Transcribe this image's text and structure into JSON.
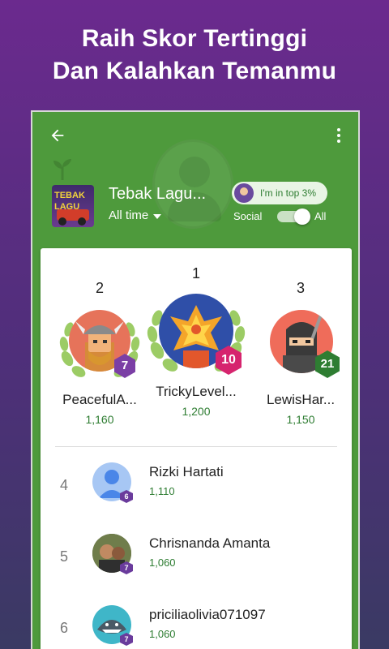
{
  "headline": {
    "line1": "Raih Skor Tertinggi",
    "line2": "Dan Kalahkan Temanmu"
  },
  "appbar": {
    "back_icon": "arrow-back-icon",
    "menu_icon": "more-vert-icon"
  },
  "game": {
    "title": "Tebak Lagu...",
    "icon_text": "TEBAK LAGU",
    "time_filter": "All time",
    "top_badge": "I'm in top 3%",
    "toggle_left": "Social",
    "toggle_right": "All",
    "toggle_on": true
  },
  "podium": [
    {
      "rank": "2",
      "name": "PeacefulA...",
      "score": "1,160",
      "level": "7",
      "level_color": "#7b3fa5",
      "avatar": "viking-avatar"
    },
    {
      "rank": "1",
      "name": "TrickyLevel...",
      "score": "1,200",
      "level": "10",
      "level_color": "#d6246e",
      "avatar": "phoenix-avatar"
    },
    {
      "rank": "3",
      "name": "LewisHar...",
      "score": "1,150",
      "level": "21",
      "level_color": "#2e7d32",
      "avatar": "ninja-avatar"
    }
  ],
  "leaderboard": [
    {
      "rank": "4",
      "name": "Rizki Hartati",
      "score": "1,110",
      "level": "6",
      "avatar": "default-person-avatar"
    },
    {
      "rank": "5",
      "name": "Chrisnanda Amanta",
      "score": "1,060",
      "level": "7",
      "avatar": "photo-avatar"
    },
    {
      "rank": "6",
      "name": "priciliaolivia071097",
      "score": "1,060",
      "level": "7",
      "avatar": "shark-avatar"
    }
  ],
  "colors": {
    "appbar_green": "#4e9a3c",
    "score_green": "#2e7d32",
    "background_purple": "#6b2a8e"
  }
}
